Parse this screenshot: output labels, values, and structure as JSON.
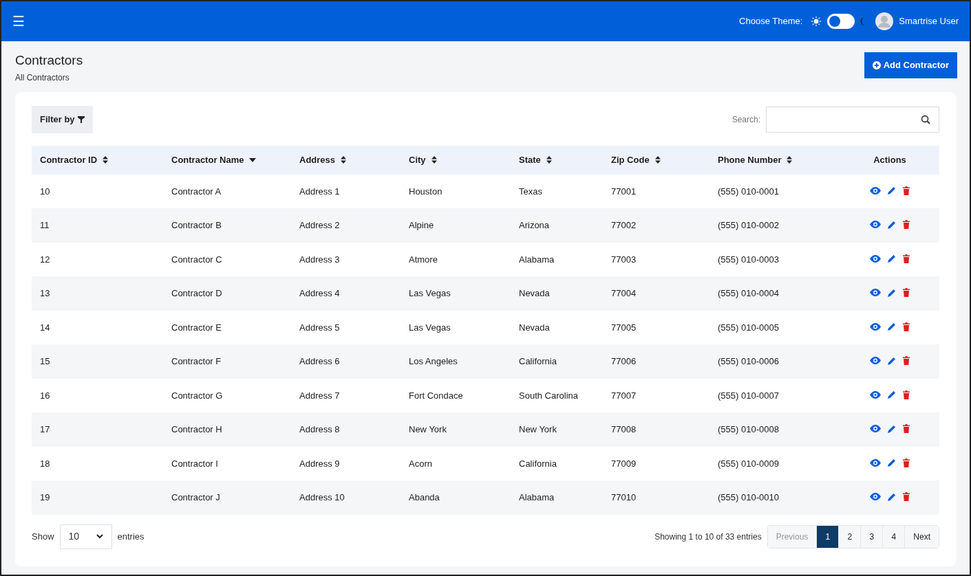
{
  "topbar": {
    "menu_icon": "☰",
    "theme_label": "Choose Theme:",
    "dark_theme": false,
    "user_name": "Smartrise User"
  },
  "page": {
    "title": "Contractors",
    "subtitle": "All Contractors",
    "add_button": "Add Contractor"
  },
  "toolbar": {
    "filter_button": "Filter by",
    "search_label": "Search:"
  },
  "table": {
    "columns": [
      {
        "label": "Contractor ID",
        "sortable": true,
        "sorted_descending": false
      },
      {
        "label": "Contractor Name",
        "sortable": true,
        "sorted_descending": true
      },
      {
        "label": "Address",
        "sortable": true,
        "sorted_descending": false
      },
      {
        "label": "City",
        "sortable": true,
        "sorted_descending": false
      },
      {
        "label": "State",
        "sortable": true,
        "sorted_descending": false
      },
      {
        "label": "Zip Code",
        "sortable": true,
        "sorted_descending": false
      },
      {
        "label": "Phone Number",
        "sortable": true,
        "sorted_descending": false
      },
      {
        "label": "Actions",
        "sortable": false
      }
    ],
    "rows": [
      [
        "10",
        "Contractor A",
        "Address 1",
        "Houston",
        "Texas",
        "77001",
        "(555) 010-0001"
      ],
      [
        "11",
        "Contractor B",
        "Address 2",
        "Alpine",
        "Arizona",
        "77002",
        "(555) 010-0002"
      ],
      [
        "12",
        "Contractor C",
        "Address 3",
        "Atmore",
        "Alabama",
        "77003",
        "(555) 010-0003"
      ],
      [
        "13",
        "Contractor D",
        "Address 4",
        "Las Vegas",
        "Nevada",
        "77004",
        "(555) 010-0004"
      ],
      [
        "14",
        "Contractor E",
        "Address 5",
        "Las Vegas",
        "Nevada",
        "77005",
        "(555) 010-0005"
      ],
      [
        "15",
        "Contractor F",
        "Address 6",
        "Los Angeles",
        "California",
        "77006",
        "(555) 010-0006"
      ],
      [
        "16",
        "Contractor G",
        "Address 7",
        "Fort Condace",
        "South Carolina",
        "77007",
        "(555) 010-0007"
      ],
      [
        "17",
        "Contractor H",
        "Address 8",
        "New York",
        "New York",
        "77008",
        "(555) 010-0008"
      ],
      [
        "18",
        "Contractor I",
        "Address 9",
        "Acorn",
        "California",
        "77009",
        "(555) 010-0009"
      ],
      [
        "19",
        "Contractor J",
        "Address 10",
        "Abanda",
        "Alabama",
        "77010",
        "(555) 010-0010"
      ]
    ]
  },
  "footer": {
    "show_label": "Show",
    "page_size": "10",
    "entries_label": "entries",
    "summary": "Showing 1 to 10 of 33 entries",
    "pagination": [
      {
        "label": "Previous",
        "kind": "nav",
        "disabled": true,
        "selected": false
      },
      {
        "label": "1",
        "kind": "page",
        "disabled": false,
        "selected": true
      },
      {
        "label": "2",
        "kind": "page",
        "disabled": false,
        "selected": false
      },
      {
        "label": "3",
        "kind": "page",
        "disabled": false,
        "selected": false
      },
      {
        "label": "4",
        "kind": "page",
        "disabled": false,
        "selected": false
      },
      {
        "label": "Next",
        "kind": "nav",
        "disabled": false,
        "selected": false
      }
    ]
  }
}
